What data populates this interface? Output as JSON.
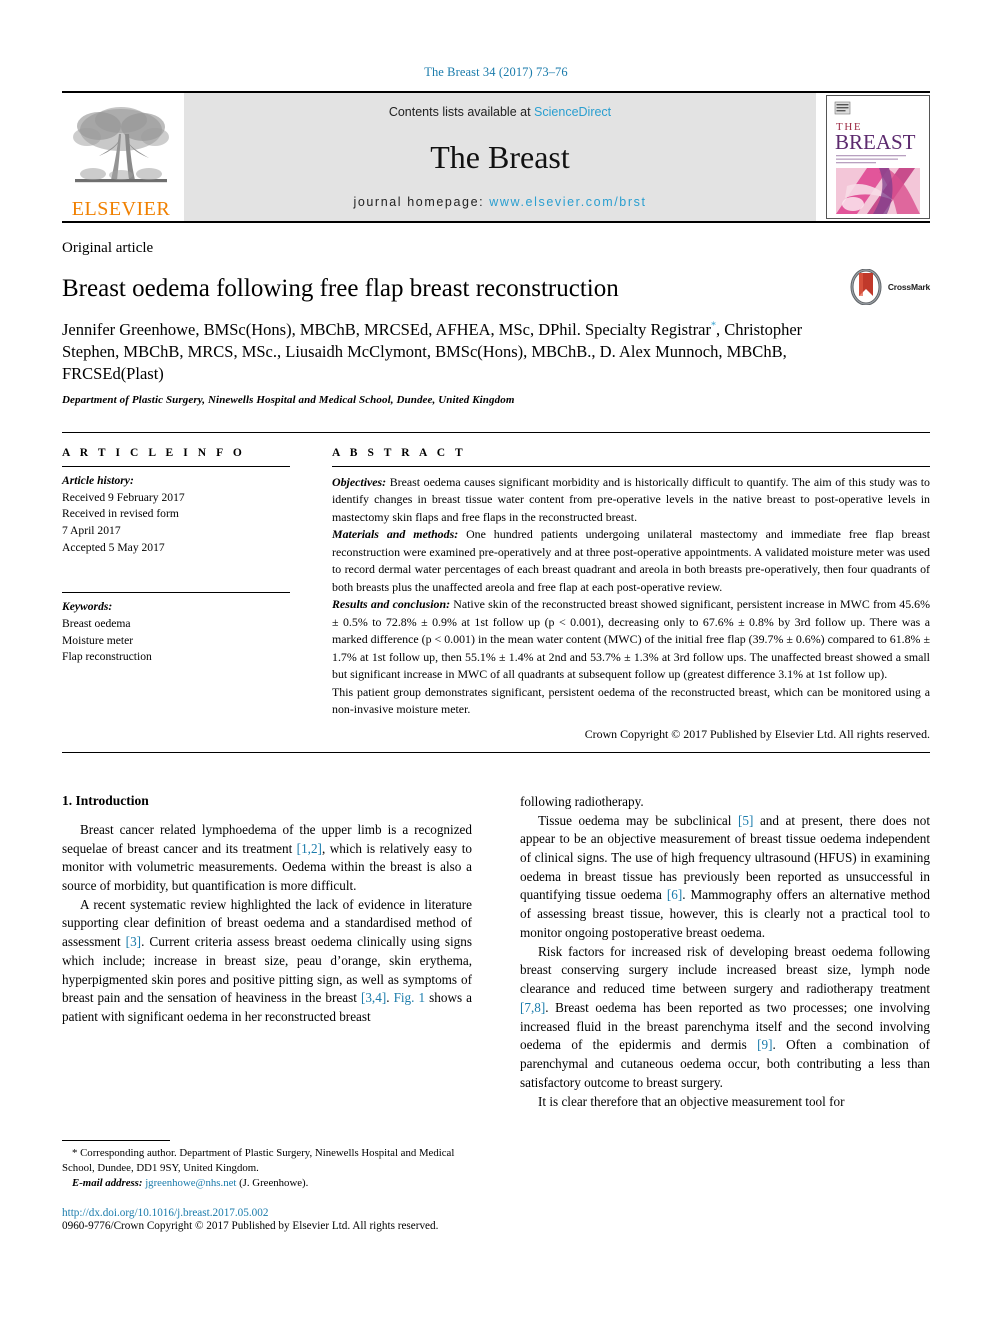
{
  "running_head": "The Breast 34 (2017) 73–76",
  "masthead": {
    "publisher_name": "ELSEVIER",
    "contents_prefix": "Contents lists available at",
    "contents_link": "ScienceDirect",
    "journal_title": "The Breast",
    "homepage_label": "journal homepage:",
    "homepage_url": "www.elsevier.com/brst",
    "cover_title_small": "THE",
    "cover_title_large": "BREAST",
    "link_color": "#2a9fd0"
  },
  "article": {
    "type": "Original article",
    "title": "Breast oedema following free flap breast reconstruction",
    "crossmark_label": "CrossMark",
    "authors": "Jennifer Greenhowe, BMSc(Hons), MBChB, MRCSEd, AFHEA, MSc, DPhil. Specialty Registrar",
    "corresponding_marker": "*",
    "authors_rest": ", Christopher Stephen, MBChB, MRCS, MSc., Liusaidh McClymont, BMSc(Hons), MBChB., D. Alex Munnoch, MBChB, FRCSEd(Plast)",
    "affiliation": "Department of Plastic Surgery, Ninewells Hospital and Medical School, Dundee, United Kingdom"
  },
  "article_info": {
    "heading": "A R T I C L E  I N F O",
    "history_label": "Article history:",
    "history": [
      "Received 9 February 2017",
      "Received in revised form",
      "7 April 2017",
      "Accepted 5 May 2017"
    ],
    "keywords_label": "Keywords:",
    "keywords": [
      "Breast oedema",
      "Moisture meter",
      "Flap reconstruction"
    ]
  },
  "abstract": {
    "heading": "A B S T R A C T",
    "objectives_label": "Objectives:",
    "objectives_text": " Breast oedema causes significant morbidity and is historically difficult to quantify. The aim of this study was to identify changes in breast tissue water content from pre-operative levels in the native breast to post-operative levels in mastectomy skin flaps and free flaps in the reconstructed breast.",
    "methods_label": "Materials and methods:",
    "methods_text": " One hundred patients undergoing unilateral mastectomy and immediate free flap breast reconstruction were examined pre-operatively and at three post-operative appointments. A validated moisture meter was used to record dermal water percentages of each breast quadrant and areola in both breasts pre-operatively, then four quadrants of both breasts plus the unaffected areola and free flap at each post-operative review.",
    "results_label": "Results and conclusion:",
    "results_text": " Native skin of the reconstructed breast showed significant, persistent increase in MWC from 45.6% ± 0.5% to 72.8% ± 0.9% at 1st follow up (p < 0.001), decreasing only to 67.6% ± 0.8% by 3rd follow up. There was a marked difference (p < 0.001) in the mean water content (MWC) of the initial free flap (39.7% ± 0.6%) compared to 61.8% ± 1.7% at 1st follow up, then 55.1% ± 1.4% at 2nd and 53.7% ± 1.3% at 3rd follow ups. The unaffected breast showed a small but significant increase in MWC of all quadrants at subsequent follow up (greatest difference 3.1% at 1st follow up).",
    "conclusion_text": "This patient group demonstrates significant, persistent oedema of the reconstructed breast, which can be monitored using a non-invasive moisture meter.",
    "copyright": "Crown Copyright © 2017 Published by Elsevier Ltd. All rights reserved."
  },
  "body": {
    "section_title": "1. Introduction",
    "left_paragraphs": [
      {
        "segments": [
          {
            "t": "Breast cancer related lymphoedema of the upper limb is a recognized sequelae of breast cancer and its treatment "
          },
          {
            "t": "[1,2]",
            "ref": true
          },
          {
            "t": ", which is relatively easy to monitor with volumetric measurements. Oedema within the breast is also a source of morbidity, but quantification is more difficult."
          }
        ]
      },
      {
        "segments": [
          {
            "t": "A recent systematic review highlighted the lack of evidence in literature supporting clear definition of breast oedema and a standardised method of assessment "
          },
          {
            "t": "[3]",
            "ref": true
          },
          {
            "t": ". Current criteria assess breast oedema clinically using signs which include; increase in breast size, peau d’orange, skin erythema, hyperpigmented skin pores and positive pitting sign, as well as symptoms of breast pain and the sensation of heaviness in the breast "
          },
          {
            "t": "[3,4]",
            "ref": true
          },
          {
            "t": ". "
          },
          {
            "t": "Fig. 1",
            "ref": true
          },
          {
            "t": " shows a patient with significant oedema in her reconstructed breast"
          }
        ]
      }
    ],
    "right_paragraphs": [
      {
        "noindent": true,
        "segments": [
          {
            "t": "following radiotherapy."
          }
        ]
      },
      {
        "segments": [
          {
            "t": "Tissue oedema may be subclinical "
          },
          {
            "t": "[5]",
            "ref": true
          },
          {
            "t": " and at present, there does not appear to be an objective measurement of breast tissue oedema independent of clinical signs. The use of high frequency ultrasound (HFUS) in examining oedema in breast tissue has previously been reported as unsuccessful in quantifying tissue oedema "
          },
          {
            "t": "[6]",
            "ref": true
          },
          {
            "t": ". Mammography offers an alternative method of assessing breast tissue, however, this is clearly not a practical tool to monitor ongoing postoperative breast oedema."
          }
        ]
      },
      {
        "segments": [
          {
            "t": "Risk factors for increased risk of developing breast oedema following breast conserving surgery include increased breast size, lymph node clearance and reduced time between surgery and radiotherapy treatment "
          },
          {
            "t": "[7,8]",
            "ref": true
          },
          {
            "t": ". Breast oedema has been reported as two processes; one involving increased fluid in the breast parenchyma itself and the second involving oedema of the epidermis and dermis "
          },
          {
            "t": "[9]",
            "ref": true
          },
          {
            "t": ". Often a combination of parenchymal and cutaneous oedema occur, both contributing a less than satisfactory outcome to breast surgery."
          }
        ]
      },
      {
        "segments": [
          {
            "t": "It is clear therefore that an objective measurement tool for"
          }
        ]
      }
    ]
  },
  "footer": {
    "corresponding_marker": "*",
    "corresponding_text": " Corresponding author. Department of Plastic Surgery, Ninewells Hospital and Medical School, Dundee, DD1 9SY, United Kingdom.",
    "email_label": "E-mail address:",
    "email": "jgreenhowe@nhs.net",
    "email_suffix": " (J. Greenhowe).",
    "doi": "http://dx.doi.org/10.1016/j.breast.2017.05.002",
    "issn_line": "0960-9776/Crown Copyright © 2017 Published by Elsevier Ltd. All rights reserved."
  }
}
